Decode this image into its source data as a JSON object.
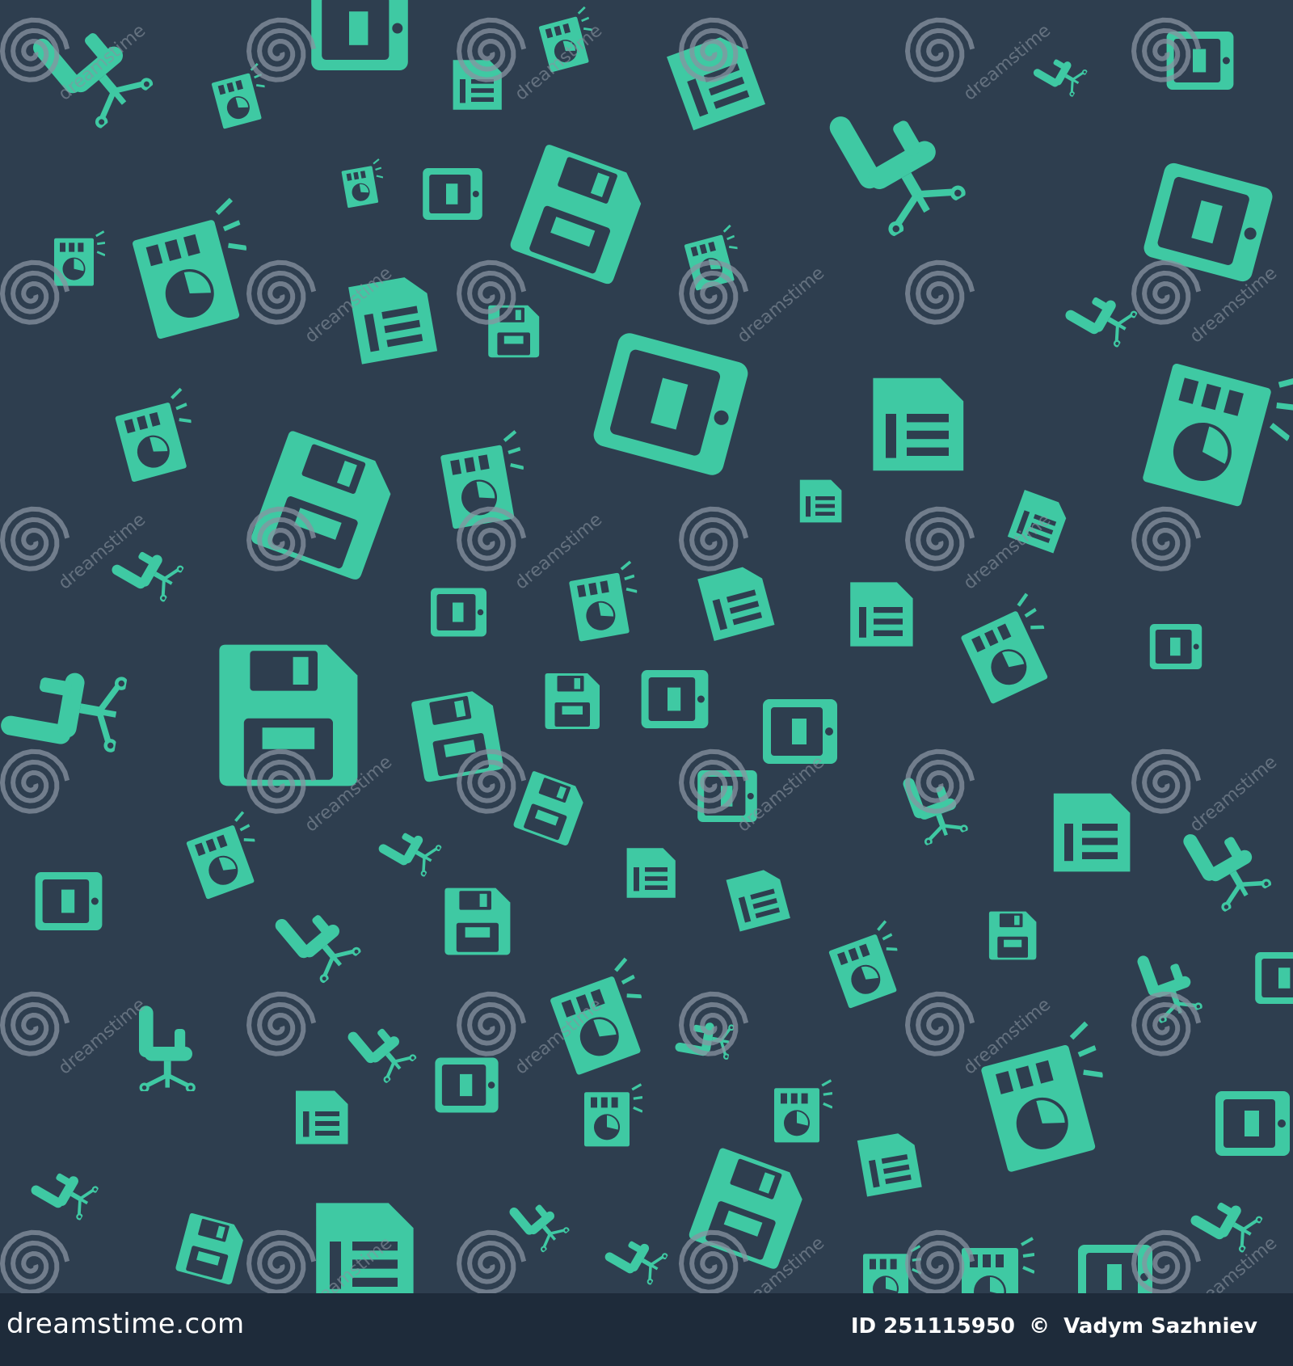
{
  "colors": {
    "background": "#2e3e4f",
    "icon": "#3fc9a3",
    "footer": "#1e2b3a",
    "footer_text": "#ffffff",
    "watermark": "#8893a0"
  },
  "pattern": {
    "icon_types": [
      "floppy-disk-icon",
      "pie-chart-board-icon",
      "office-chair-icon",
      "sd-card-icon"
    ],
    "watermark_text": "dreamstime"
  },
  "footer": {
    "logo_text": "dreamstime.com",
    "id_text": "ID 251115950",
    "copyright_symbol": "©",
    "author": "Vadym Sazhniev"
  }
}
